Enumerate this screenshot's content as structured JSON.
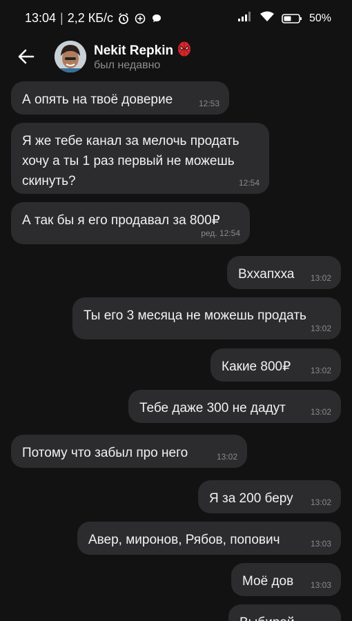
{
  "status_bar": {
    "time": "13:04",
    "network_speed": "2,2 КБ/с",
    "battery_percent": "50%",
    "icons": [
      "alarm-icon",
      "plus-circle-icon",
      "chat-bubble-icon",
      "signal-icon",
      "wifi-icon",
      "battery-icon"
    ]
  },
  "header": {
    "name": "Nekit Repkin",
    "status": "был недавно",
    "name_icon": "spider-mask-icon"
  },
  "messages": [
    {
      "side": "in",
      "text": "А опять на твоё доверие",
      "time": "12:53"
    },
    {
      "side": "in",
      "text": "Я же тебе канал за мелочь продать\nхочу а ты 1 раз первый не можешь\nскинуть?",
      "time": "12:54"
    },
    {
      "side": "in",
      "text": "А так бы я его продавал за 800₽",
      "time": "ред. 12:54"
    },
    {
      "side": "out",
      "text": "Вххапхха",
      "time": "13:02"
    },
    {
      "side": "out",
      "text": "Ты его 3 месяца не можешь продать",
      "time": "13:02"
    },
    {
      "side": "out",
      "text": "Какие 800₽",
      "time": "13:02"
    },
    {
      "side": "out",
      "text": "Тебе даже 300 не дадут",
      "time": "13:02"
    },
    {
      "side": "in",
      "text": "Потому что забыл про него",
      "time": "13:02"
    },
    {
      "side": "out",
      "text": "Я за 200 беру",
      "time": "13:02"
    },
    {
      "side": "out",
      "text": "Авер, миронов, Рябов, попович",
      "time": "13:03"
    },
    {
      "side": "out",
      "text": "Моё дов",
      "time": "13:03"
    },
    {
      "side": "out",
      "text": "Выбирай",
      "time": ""
    }
  ]
}
